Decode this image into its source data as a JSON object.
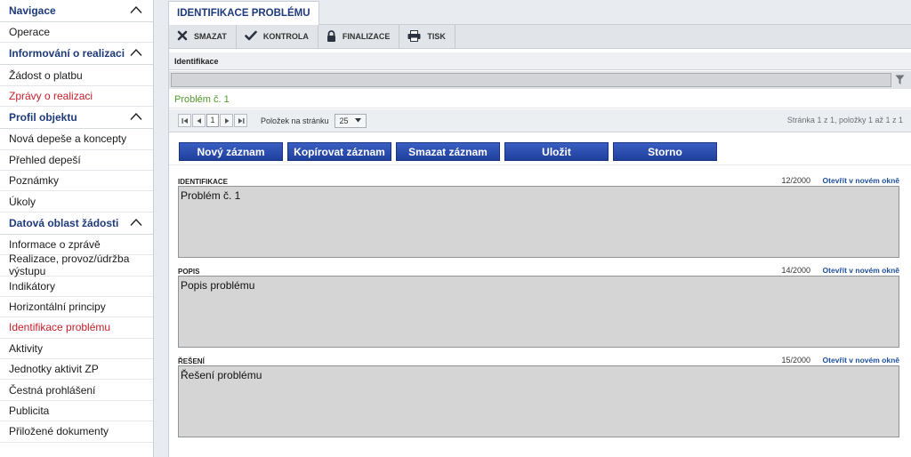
{
  "sidebar": {
    "sections": [
      {
        "title": "Navigace",
        "items": [
          {
            "label": "Operace",
            "active": false
          }
        ]
      },
      {
        "title": "Informování o realizaci",
        "items": [
          {
            "label": "Žádost o platbu",
            "active": false
          },
          {
            "label": "Zprávy o realizaci",
            "active": true
          }
        ]
      },
      {
        "title": "Profil objektu",
        "items": [
          {
            "label": "Nová depeše a koncepty",
            "active": false
          },
          {
            "label": "Přehled depeší",
            "active": false
          },
          {
            "label": "Poznámky",
            "active": false
          },
          {
            "label": "Úkoly",
            "active": false
          }
        ]
      },
      {
        "title": "Datová oblast žádosti",
        "items": [
          {
            "label": "Informace o zprávě",
            "active": false
          },
          {
            "label": "Realizace, provoz/údržba výstupu",
            "active": false
          },
          {
            "label": "Indikátory",
            "active": false
          },
          {
            "label": "Horizontální principy",
            "active": false
          },
          {
            "label": "Identifikace problému",
            "active": true
          },
          {
            "label": "Aktivity",
            "active": false
          },
          {
            "label": "Jednotky aktivit ZP",
            "active": false
          },
          {
            "label": "Čestná prohlášení",
            "active": false
          },
          {
            "label": "Publicita",
            "active": false
          },
          {
            "label": "Přiložené dokumenty",
            "active": false
          }
        ]
      }
    ]
  },
  "tab": {
    "label": "IDENTIFIKACE PROBLÉMU"
  },
  "toolbar": {
    "delete": "SMAZAT",
    "check": "KONTROLA",
    "finalize": "FINALIZACE",
    "print": "TISK"
  },
  "grid": {
    "column_header": "Identifikace",
    "filter_value": "",
    "rows": [
      "Problém č. 1"
    ]
  },
  "pager": {
    "current_page": "1",
    "items_per_page_label": "Položek na stránku",
    "page_size": "25",
    "info": "Stránka 1 z 1, položky 1 až 1 z 1"
  },
  "actions": {
    "new": "Nový záznam",
    "copy": "Kopírovat záznam",
    "delete": "Smazat záznam",
    "save": "Uložit",
    "cancel": "Storno"
  },
  "fields": [
    {
      "label": "IDENTIFIKACE",
      "count": "12/2000",
      "link": "Otevřít v novém okně",
      "value": "Problém č. 1"
    },
    {
      "label": "POPIS",
      "count": "14/2000",
      "link": "Otevřít v novém okně",
      "value": "Popis problému"
    },
    {
      "label": "ŘEŠENÍ",
      "count": "15/2000",
      "link": "Otevřít v novém okně",
      "value": "Řešení problému"
    }
  ],
  "colors": {
    "accent_blue": "#1d3a7a",
    "active_red": "#c41f2a",
    "row_green": "#4f9a2b",
    "button_blue": "#2a4db0"
  }
}
